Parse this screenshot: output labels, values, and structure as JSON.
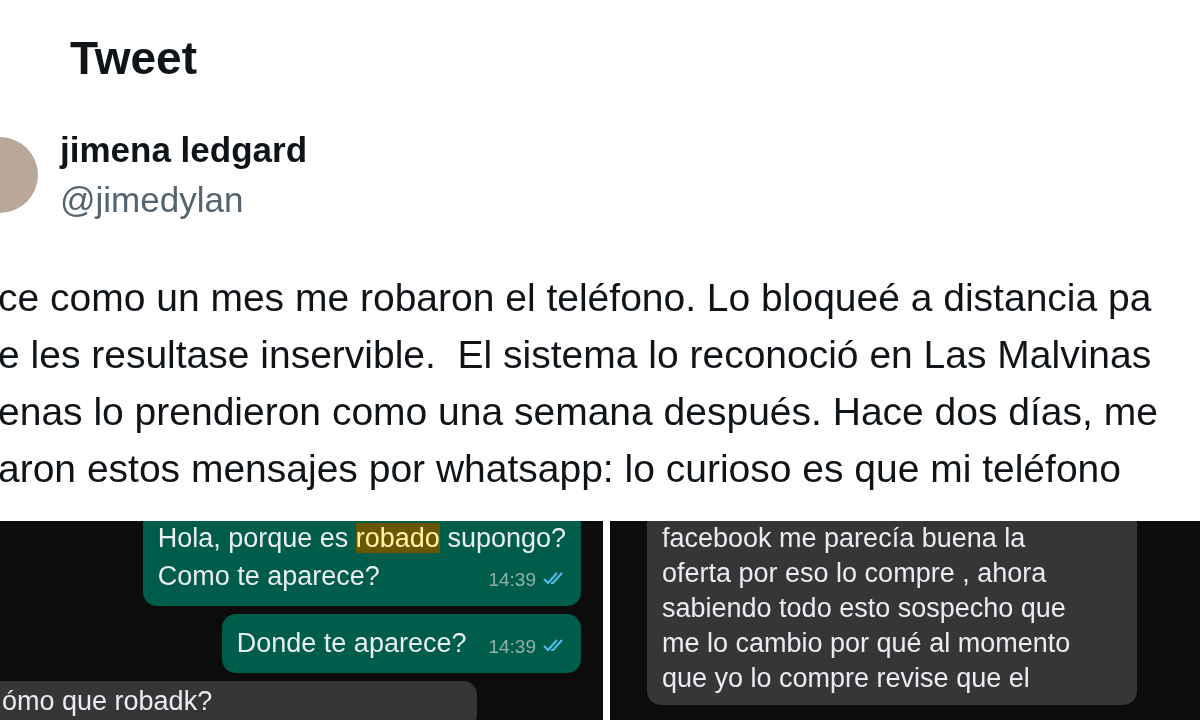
{
  "page": {
    "title": "Tweet"
  },
  "author": {
    "name": "jimena ledgard",
    "handle": "@jimedylan"
  },
  "tweet_lines": [
    "ce como un mes me robaron el teléfono. Lo bloqueé a distancia pa",
    "e les resultase inservible.  El sistema lo reconoció en Las Malvinas",
    "enas lo prendieron como una semana después. Hace dos días, me",
    "aron estos mensajes por whatsapp: lo curioso es que mi teléfono"
  ],
  "chat_screenshots": [
    {
      "messages": [
        {
          "kind": "outgoing",
          "time": "14:39",
          "read": true,
          "lines": [
            {
              "segments": [
                {
                  "text": "Hola, porque es ",
                  "highlighted": false
                },
                {
                  "text": "robado",
                  "highlighted": true
                },
                {
                  "text": " supongo?",
                  "highlighted": false
                }
              ]
            },
            {
              "segments": [
                {
                  "text": "Como te aparece?",
                  "highlighted": false
                }
              ]
            }
          ]
        },
        {
          "kind": "outgoing",
          "time": "14:39",
          "read": true,
          "lines": [
            {
              "segments": [
                {
                  "text": "Donde te aparece?",
                  "highlighted": false
                }
              ]
            }
          ]
        },
        {
          "kind": "incoming",
          "lines": [
            {
              "segments": [
                {
                  "text": "ómo que robadk?",
                  "highlighted": false
                }
              ]
            }
          ]
        }
      ]
    },
    {
      "messages": [
        {
          "kind": "incoming",
          "lines": [
            {
              "segments": [
                {
                  "text": "facebook me parecía buena la",
                  "highlighted": false
                }
              ]
            },
            {
              "segments": [
                {
                  "text": "oferta por eso lo compre , ahora",
                  "highlighted": false
                }
              ]
            },
            {
              "segments": [
                {
                  "text": "sabiendo todo esto sospecho que",
                  "highlighted": false
                }
              ]
            },
            {
              "segments": [
                {
                  "text": "me lo cambio por qué al momento",
                  "highlighted": false
                }
              ]
            },
            {
              "segments": [
                {
                  "text": "que yo lo compre revise que el",
                  "highlighted": false
                }
              ]
            }
          ]
        }
      ]
    }
  ]
}
